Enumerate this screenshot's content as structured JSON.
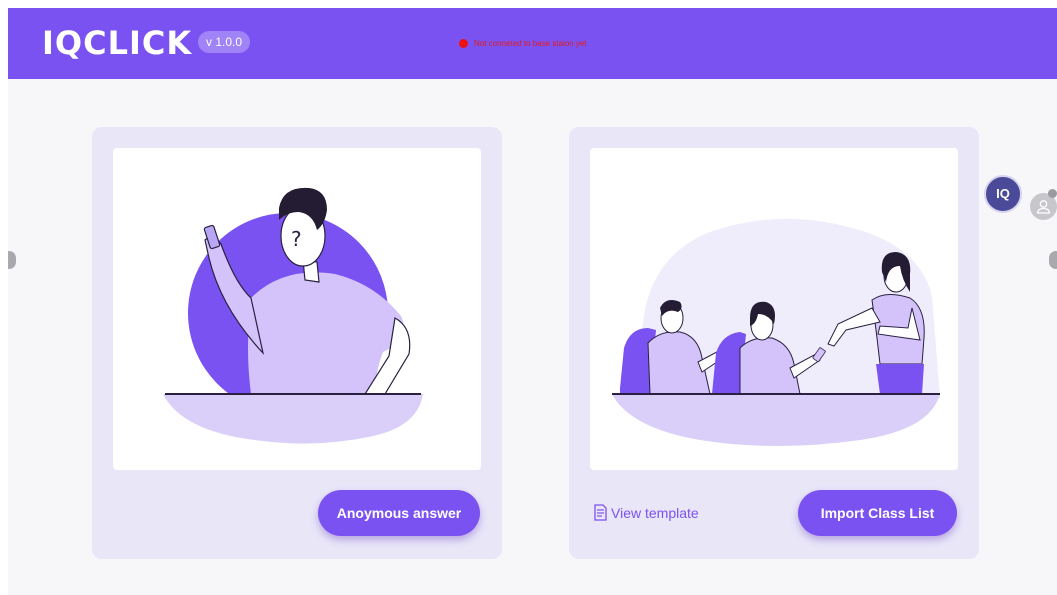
{
  "header": {
    "logo_text": "IQCLICK",
    "version": "v 1.0.0",
    "status_text": "Not conneted to base staion yet",
    "colors": {
      "brand": "#7b52f2",
      "status_dot": "#ee1111"
    }
  },
  "cards": {
    "anonymous": {
      "button_label": "Anoymous answer"
    },
    "class_list": {
      "template_link": "View template",
      "button_label": "Import Class List"
    }
  },
  "side": {
    "iq_badge_label": "IQ"
  },
  "icons": [
    "question-person-illustration",
    "classroom-illustration",
    "document-icon",
    "user-icon",
    "iq-icon"
  ]
}
